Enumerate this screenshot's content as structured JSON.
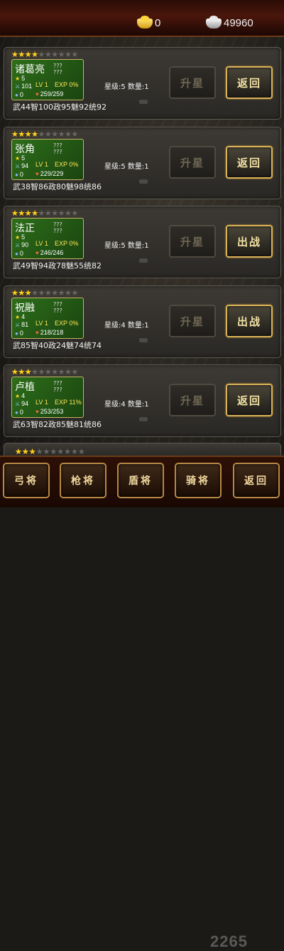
{
  "currency": {
    "gold": "0",
    "silver": "49960",
    "gold_icon": "gold-ingot-icon",
    "silver_icon": "silver-ingot-icon"
  },
  "heroes": [
    {
      "name": "诸葛亮",
      "stars_on": 4,
      "stars_total": 10,
      "q1": "???",
      "q2": "???",
      "level_star": "5",
      "lv": "LV 1",
      "exp": "EXP 0%",
      "attack": "101",
      "hp": "259/259",
      "mana": "0",
      "stats": "武44智100政95魅92统92",
      "grade": "星级:5 数量:1",
      "btn_left": "升星",
      "btn_right": "返回"
    },
    {
      "name": "张角",
      "stars_on": 4,
      "stars_total": 10,
      "q1": "???",
      "q2": "???",
      "level_star": "5",
      "lv": "LV 1",
      "exp": "EXP 0%",
      "attack": "94",
      "hp": "229/229",
      "mana": "0",
      "stats": "武38智86政80魅98统86",
      "grade": "星级:5 数量:1",
      "btn_left": "升星",
      "btn_right": "返回"
    },
    {
      "name": "法正",
      "stars_on": 4,
      "stars_total": 10,
      "q1": "???",
      "q2": "???",
      "level_star": "5",
      "lv": "LV 1",
      "exp": "EXP 0%",
      "attack": "90",
      "hp": "246/246",
      "mana": "0",
      "stats": "武49智94政78魅55统82",
      "grade": "星级:5 数量:1",
      "btn_left": "升星",
      "btn_right": "出战"
    },
    {
      "name": "祝融",
      "stars_on": 3,
      "stars_total": 10,
      "q1": "???",
      "q2": "???",
      "level_star": "4",
      "lv": "LV 1",
      "exp": "EXP 0%",
      "attack": "81",
      "hp": "218/218",
      "mana": "0",
      "stats": "武85智40政24魅74统74",
      "grade": "星级:4 数量:1",
      "btn_left": "升星",
      "btn_right": "出战"
    },
    {
      "name": "卢植",
      "stars_on": 3,
      "stars_total": 10,
      "q1": "???",
      "q2": "???",
      "level_star": "4",
      "lv": "LV 1",
      "exp": "EXP 11%",
      "attack": "94",
      "hp": "253/253",
      "mana": "0",
      "stats": "武63智82政85魅81统86",
      "grade": "星级:4 数量:1",
      "btn_left": "升星",
      "btn_right": "返回"
    }
  ],
  "partial_row": {
    "stars_on": 3,
    "stars_total": 10
  },
  "bottom_tabs": [
    "弓将",
    "枪将",
    "盾将",
    "骑将",
    "返回"
  ],
  "watermark": "2265"
}
